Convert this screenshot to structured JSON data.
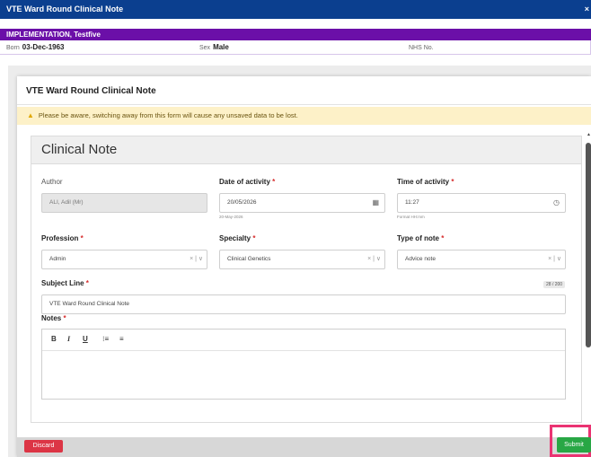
{
  "window": {
    "title": "VTE Ward Round Clinical Note",
    "close": "×"
  },
  "patient": {
    "name": "IMPLEMENTATION, Testfive",
    "born_label": "Born",
    "born_value": "03-Dec-1963",
    "sex_label": "Sex",
    "sex_value": "Male",
    "nhs_label": "NHS No.",
    "nhs_value": ""
  },
  "modal": {
    "title": "VTE Ward Round Clinical Note",
    "alert_icon": "warning-icon",
    "alert_text": "Please be aware, switching away from this form will cause any unsaved data to be lost."
  },
  "card": {
    "title": "Clinical Note"
  },
  "fields": {
    "author": {
      "label": "Author",
      "value": "ALI, Adil (Mr)"
    },
    "date": {
      "label": "Date of activity",
      "value": "20/05/2026",
      "hint": "20-May-2026",
      "icon": "calendar-icon"
    },
    "time": {
      "label": "Time of activity",
      "value": "11:27",
      "hint": "Format HH:mm",
      "icon": "clock-icon"
    },
    "profession": {
      "label": "Profession",
      "value": "Admin"
    },
    "specialty": {
      "label": "Specialty",
      "value": "Clinical Genetics"
    },
    "note_type": {
      "label": "Type of note",
      "value": "Advice note"
    },
    "subject": {
      "label": "Subject Line",
      "value": "VTE Ward Round Clinical Note",
      "counter": "28 / 200"
    },
    "notes": {
      "label": "Notes"
    }
  },
  "required_mark": "*",
  "select_controls": "×  |  ∨",
  "editor_toolbar": {
    "bold": "B",
    "italic": "I",
    "underline": "U",
    "ordered_list": "⁝≡",
    "bullet_list": "≡"
  },
  "buttons": {
    "discard": "Discard",
    "submit": "Submit"
  },
  "colors": {
    "title_bar": "#0b3f8f",
    "patient_bar": "#6b0fa8",
    "discard": "#dc3545",
    "submit": "#28a745",
    "highlight": "#ea3372"
  }
}
